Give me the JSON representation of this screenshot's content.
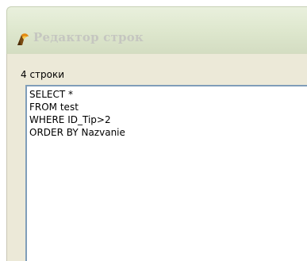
{
  "window": {
    "title": "Редактор строк",
    "icon": "delphi-flame-icon"
  },
  "editor": {
    "line_count_label": "4 строки",
    "lines": [
      "SELECT *",
      "FROM test",
      "WHERE ID_Tip>2",
      "ORDER BY Nazvanie"
    ]
  },
  "colors": {
    "titlebar": "#dfe8cf",
    "dialog_background": "#ece9d8",
    "editor_border": "#7f9db9",
    "title_text": "#c5c6c0"
  }
}
